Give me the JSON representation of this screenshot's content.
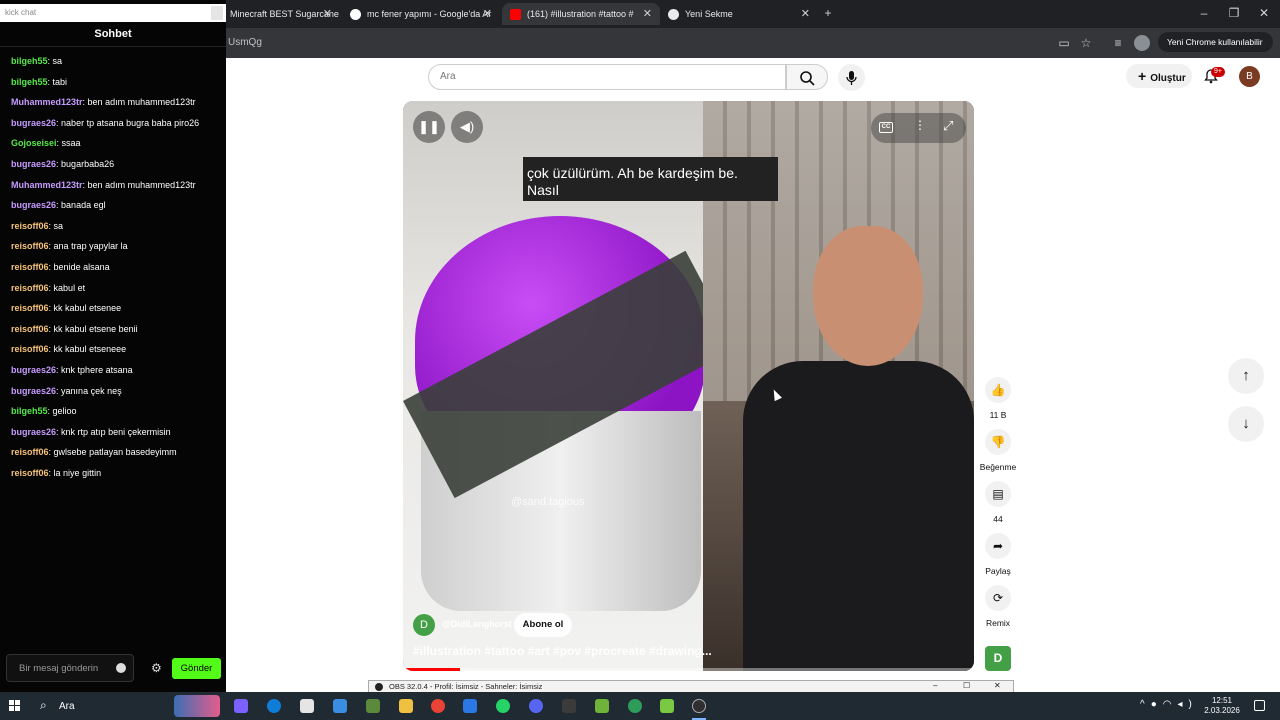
{
  "browser": {
    "tabs": [
      {
        "label": "Minecraft BEST Sugarcane",
        "active": false
      },
      {
        "label": "mc fener yapımı - Google'da Ar",
        "active": false
      },
      {
        "label": "(161) #illustration #tattoo #",
        "active": true
      },
      {
        "label": "Yeni Sekme",
        "active": false
      }
    ],
    "url": "UsmQg",
    "update_button": "Yeni Chrome kullanılabilir"
  },
  "chat": {
    "search_placeholder": "kick chat",
    "title": "Sohbet",
    "messages": [
      {
        "user": "bilgeh55",
        "text": "sa",
        "color": "#56e84a"
      },
      {
        "user": "bilgeh55",
        "text": "tabi",
        "color": "#56e84a"
      },
      {
        "user": "Muhammed123tr",
        "text": "ben adım muhammed123tr",
        "color": "#c79bff"
      },
      {
        "user": "bugraes26",
        "text": "naber tp atsana bugra baba piro26",
        "color": "#c79bff"
      },
      {
        "user": "Gojoseisei",
        "text": "ssaa",
        "color": "#56e84a"
      },
      {
        "user": "bugraes26",
        "text": "bugarbaba26",
        "color": "#c79bff"
      },
      {
        "user": "Muhammed123tr",
        "text": "ben adım muhammed123tr",
        "color": "#c79bff"
      },
      {
        "user": "bugraes26",
        "text": "banada egl",
        "color": "#c79bff"
      },
      {
        "user": "reisoff06",
        "text": "sa",
        "color": "#f4c27a"
      },
      {
        "user": "reisoff06",
        "text": "ana trap yapylar la",
        "color": "#f4c27a"
      },
      {
        "user": "reisoff06",
        "text": "benide alsana",
        "color": "#f4c27a"
      },
      {
        "user": "reisoff06",
        "text": "kabul et",
        "color": "#f4c27a"
      },
      {
        "user": "reisoff06",
        "text": "kk kabul etsenee",
        "color": "#f4c27a"
      },
      {
        "user": "reisoff06",
        "text": "kk kabul etsene benii",
        "color": "#f4c27a"
      },
      {
        "user": "reisoff06",
        "text": "kk kabul etseneee",
        "color": "#f4c27a"
      },
      {
        "user": "bugraes26",
        "text": "knk tphere atsana",
        "color": "#c79bff"
      },
      {
        "user": "bugraes26",
        "text": "yanına çek neş",
        "color": "#c79bff"
      },
      {
        "user": "bilgeh55",
        "text": "gelioo",
        "color": "#56e84a"
      },
      {
        "user": "bugraes26",
        "text": "knk rtp atıp beni çekermisin",
        "color": "#c79bff"
      },
      {
        "user": "reisoff06",
        "text": "gwlsebe patlayan basedeyimm",
        "color": "#f4c27a"
      },
      {
        "user": "reisoff06",
        "text": "la niye gittin",
        "color": "#f4c27a"
      }
    ],
    "input_placeholder": "Bir mesaj gönderin",
    "send_label": "Gönder"
  },
  "youtube": {
    "search_placeholder": "Ara",
    "create_label": "Oluştur",
    "notif_badge": "9+",
    "avatar_letter": "B",
    "video": {
      "caption_line1": "çok üzülürüm. Ah be kardeşim be.",
      "caption_line2": "Nasıl",
      "watermark": "@sand.tagious",
      "cc_label": "CC",
      "channel_letter": "D",
      "channel_name": "@DidiLanghorst",
      "subscribe_label": "Abone ol",
      "title": "#illustration #tattoo #art #pov #procreate #drawing...",
      "progress": 0.1
    },
    "rail": {
      "likes": "11 B",
      "dislike_label": "Beğenme",
      "comments": "44",
      "share_label": "Paylaş",
      "remix_label": "Remix",
      "remix_letter": "D"
    }
  },
  "obs": {
    "title": "OBS 32.0.4 - Profil: İsimsiz - Sahneler: İsimsiz"
  },
  "taskbar": {
    "search_label": "Ara",
    "time": "12:51",
    "date": "2.03.2026"
  }
}
